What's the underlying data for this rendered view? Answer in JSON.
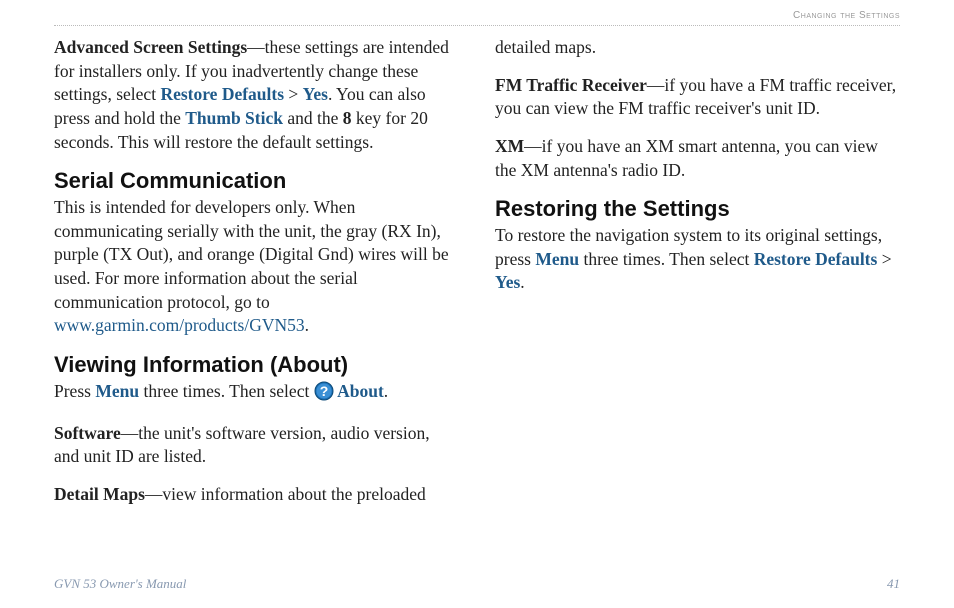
{
  "header": {
    "section_title": "Changing the Settings"
  },
  "left": {
    "p1": {
      "t1": "Advanced Screen Settings",
      "t2": "—these settings are intended for installers only. If you inadvertently change these settings, select ",
      "t3": "Restore Defaults",
      "t4": " > ",
      "t5": "Yes",
      "t6": ". You can also press and hold the ",
      "t7": "Thumb Stick",
      "t8": " and the ",
      "t9": "8",
      "t10": " key for 20 seconds. This will restore the default settings."
    },
    "h1": "Serial Communication",
    "p2": {
      "t1": "This is intended for developers only. When communicating serially with the unit, the gray (RX In), purple (TX Out), and orange (Digital Gnd) wires will be used. For more information about the serial communication protocol, go to ",
      "t2": "www.garmin.com/products/GVN53",
      "t3": "."
    },
    "h2": "Viewing Information (About)",
    "p3": {
      "t1": "Press ",
      "t2": "Menu",
      "t3": " three times. Then select ",
      "t4": " About",
      "t5": "."
    },
    "p4": {
      "t1": "Software",
      "t2": "—the unit's software version, audio version, and unit ID are listed."
    },
    "p5": {
      "t1": "Detail Maps",
      "t2": "—view information about the preloaded"
    }
  },
  "right": {
    "p1": {
      "t1": "detailed maps."
    },
    "p2": {
      "t1": "FM Traffic Receiver",
      "t2": "—if you have a FM traffic receiver, you can view the FM traffic receiver's unit ID."
    },
    "p3": {
      "t1": "XM",
      "t2": "—if you have an XM smart antenna, you can view the XM antenna's radio ID."
    },
    "h1": "Restoring the Settings",
    "p4": {
      "t1": "To restore the navigation system to its original settings, press ",
      "t2": "Menu",
      "t3": " three times. Then select ",
      "t4": "Restore Defaults",
      "t5": " > ",
      "t6": "Yes",
      "t7": "."
    }
  },
  "footer": {
    "left": "GVN 53 Owner's Manual",
    "right": "41"
  }
}
